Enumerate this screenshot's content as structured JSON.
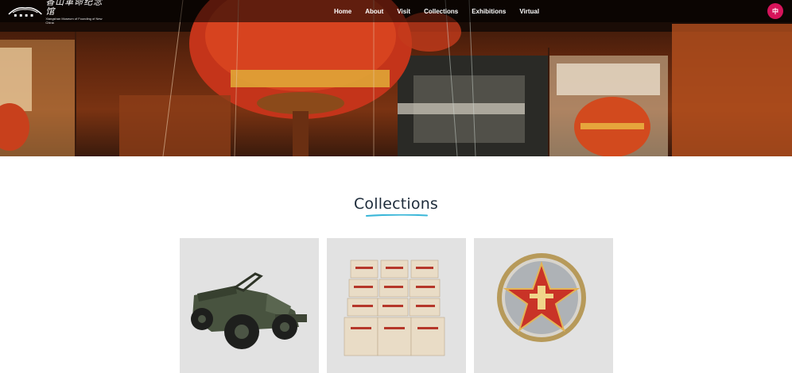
{
  "header": {
    "logo_cn": "香山革命纪念馆",
    "logo_en": "Xiangshan Museum of Founding of New China",
    "nav": [
      "Home",
      "About",
      "Visit",
      "Collections",
      "Exhibitions",
      "Virtual"
    ],
    "lang_button": "中"
  },
  "main": {
    "section_title": "Collections",
    "cards": [
      {
        "name": "military-jeep"
      },
      {
        "name": "stack-of-books"
      },
      {
        "name": "star-badge"
      }
    ]
  },
  "colors": {
    "accent": "#d6145a",
    "title": "#1d2b3a",
    "underline": "#39b6d8",
    "card_bg": "#e2e2e2"
  }
}
